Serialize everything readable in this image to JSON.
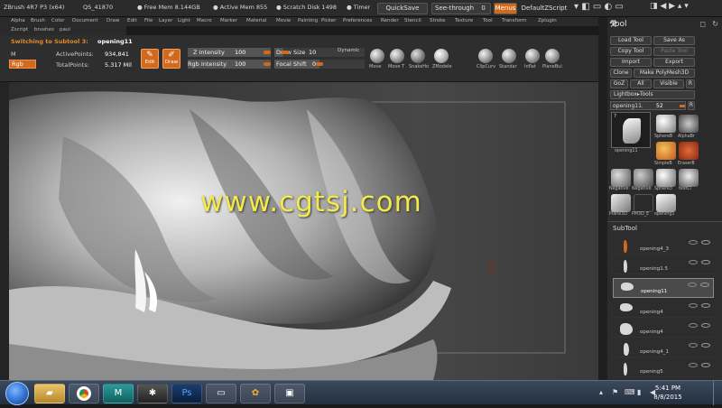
{
  "titlebar": {
    "app": "ZBrush 4R7 P3 (x64)",
    "qs": "QS_41870",
    "free_mem": "● Free Mem 8.144GB",
    "active_mem": "● Active Mem 855",
    "scratch": "● Scratch Disk 1498",
    "timer": "● Timer",
    "quicksave": "QuickSave",
    "see_through": "See-through",
    "see_through_val": "0",
    "menus": "Menus",
    "default_script": "DefaultZScript"
  },
  "menu_row1": [
    "Alpha",
    "Brush",
    "Color",
    "Document",
    "Draw",
    "Edit",
    "File",
    "Layer",
    "Light",
    "Macro",
    "Marker",
    "Material",
    "Movie",
    "Painting",
    "Picker",
    "Preferences",
    "Render",
    "Stencil",
    "Stroke",
    "Texture",
    "Tool",
    "Transform",
    "Zplugin"
  ],
  "menu_row2": [
    "Zscript",
    "brushes",
    "paul"
  ],
  "toolshelf": {
    "switching_label": "Switching to Subtool 3:",
    "switching_value": "opening11",
    "m_label": "M",
    "rgb_label": "Rgb",
    "active_points_label": "ActivePoints:",
    "active_points_value": "934,841",
    "total_points_label": "TotalPoints:",
    "total_points_value": "5.317 Mil",
    "edit_label": "Edit",
    "draw_label": "Draw",
    "z_intensity_label": "Z Intensity",
    "z_intensity_value": "100",
    "rgb_intensity_label": "Rgb Intensity",
    "rgb_intensity_value": "100",
    "draw_size_label": "Draw Size",
    "draw_size_value": "10",
    "focal_shift_label": "Focal Shift",
    "focal_shift_value": "0",
    "dynamic_label": "Dynamic",
    "brushes": [
      "Move",
      "Move T",
      "SnakeHo",
      "ZModele",
      "ClipCurv",
      "Standar",
      "Inflat",
      "PlaneBui"
    ]
  },
  "watermark": "www.cgtsj.com",
  "right_panel": {
    "header": "Tool",
    "load_tool": "Load Tool",
    "save_as": "Save As",
    "copy_tool": "Copy Tool",
    "paste_tool": "Paste Tool",
    "import": "Import",
    "export": "Export",
    "clone": "Clone",
    "make_polymesh": "Make PolyMesh3D",
    "goz": "GoZ",
    "all": "All",
    "visible": "Visible",
    "r": "R",
    "lightbox_tools": "Lightbox▸Tools",
    "current_tool": "opening11.",
    "current_tool_value": "52",
    "r2": "R",
    "thumb_count": "7",
    "thumb_labels": [
      "opening11",
      "SphereB",
      "AlphaBr",
      "SimpleB",
      "EraserB",
      "Negative",
      "Negative",
      "Sphere3",
      "testCl",
      "Plane3D",
      "PM3D_E",
      "opening1"
    ],
    "subtool_header": "SubTool",
    "subtools": [
      "opening4_3",
      "opening1.5",
      "opening11",
      "opening4",
      "opening4",
      "opening4_1",
      "opening5"
    ]
  },
  "taskbar": {
    "time": "5:41 PM",
    "date": "8/8/2015",
    "apps": [
      "folder",
      "chrome",
      "maya",
      "zbrush",
      "photoshop",
      "tablet",
      "flower",
      "window"
    ]
  },
  "colors": {
    "accent": "#d26a1e",
    "watermark": "#f3e94a",
    "panel_bg": "#2a2a2a",
    "canvas_bg": "#434343"
  }
}
